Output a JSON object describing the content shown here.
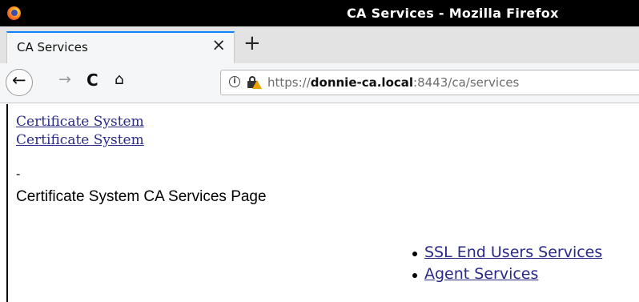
{
  "window": {
    "title": "CA Services - Mozilla Firefox"
  },
  "tabs": [
    {
      "label": "CA Services",
      "close_glyph": "×"
    }
  ],
  "newtab_glyph": "+",
  "nav": {
    "back_glyph": "←",
    "forward_glyph": "→",
    "reload_glyph": "C",
    "home_glyph": "⌂",
    "info_glyph": "i"
  },
  "urlbar": {
    "scheme": "https://",
    "host": "donnie-ca.local",
    "rest": ":8443/ca/services"
  },
  "content": {
    "links_top": [
      "Certificate System",
      "Certificate System"
    ],
    "dash": "-",
    "heading": "Certificate System CA Services Page",
    "services": [
      "SSL End Users Services",
      "Agent Services"
    ]
  },
  "colors": {
    "link": "#2a2a8a",
    "tab_accent": "#0a84ff",
    "titlebar": "#000000"
  }
}
